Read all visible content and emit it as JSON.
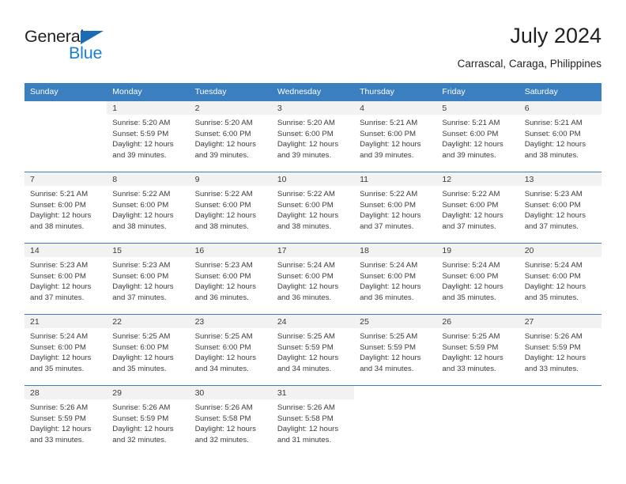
{
  "brand": {
    "name_part1": "General",
    "name_part2": "Blue",
    "triangle_color": "#1b6cb5",
    "blue_color": "#1b7fd4"
  },
  "header": {
    "title": "July 2024",
    "location": "Carrascal, Caraga, Philippines"
  },
  "theme": {
    "header_bg": "#3c7fc0",
    "header_text": "#ffffff",
    "daynum_strip_bg": "#f2f2f2",
    "grid_line": "#3c7fc0",
    "body_text": "#3b3b3b"
  },
  "weekdays": [
    "Sunday",
    "Monday",
    "Tuesday",
    "Wednesday",
    "Thursday",
    "Friday",
    "Saturday"
  ],
  "weeks": [
    [
      {
        "day": "",
        "sunrise": "",
        "sunset": "",
        "daylight1": "",
        "daylight2": ""
      },
      {
        "day": "1",
        "sunrise": "Sunrise: 5:20 AM",
        "sunset": "Sunset: 5:59 PM",
        "daylight1": "Daylight: 12 hours",
        "daylight2": "and 39 minutes."
      },
      {
        "day": "2",
        "sunrise": "Sunrise: 5:20 AM",
        "sunset": "Sunset: 6:00 PM",
        "daylight1": "Daylight: 12 hours",
        "daylight2": "and 39 minutes."
      },
      {
        "day": "3",
        "sunrise": "Sunrise: 5:20 AM",
        "sunset": "Sunset: 6:00 PM",
        "daylight1": "Daylight: 12 hours",
        "daylight2": "and 39 minutes."
      },
      {
        "day": "4",
        "sunrise": "Sunrise: 5:21 AM",
        "sunset": "Sunset: 6:00 PM",
        "daylight1": "Daylight: 12 hours",
        "daylight2": "and 39 minutes."
      },
      {
        "day": "5",
        "sunrise": "Sunrise: 5:21 AM",
        "sunset": "Sunset: 6:00 PM",
        "daylight1": "Daylight: 12 hours",
        "daylight2": "and 39 minutes."
      },
      {
        "day": "6",
        "sunrise": "Sunrise: 5:21 AM",
        "sunset": "Sunset: 6:00 PM",
        "daylight1": "Daylight: 12 hours",
        "daylight2": "and 38 minutes."
      }
    ],
    [
      {
        "day": "7",
        "sunrise": "Sunrise: 5:21 AM",
        "sunset": "Sunset: 6:00 PM",
        "daylight1": "Daylight: 12 hours",
        "daylight2": "and 38 minutes."
      },
      {
        "day": "8",
        "sunrise": "Sunrise: 5:22 AM",
        "sunset": "Sunset: 6:00 PM",
        "daylight1": "Daylight: 12 hours",
        "daylight2": "and 38 minutes."
      },
      {
        "day": "9",
        "sunrise": "Sunrise: 5:22 AM",
        "sunset": "Sunset: 6:00 PM",
        "daylight1": "Daylight: 12 hours",
        "daylight2": "and 38 minutes."
      },
      {
        "day": "10",
        "sunrise": "Sunrise: 5:22 AM",
        "sunset": "Sunset: 6:00 PM",
        "daylight1": "Daylight: 12 hours",
        "daylight2": "and 38 minutes."
      },
      {
        "day": "11",
        "sunrise": "Sunrise: 5:22 AM",
        "sunset": "Sunset: 6:00 PM",
        "daylight1": "Daylight: 12 hours",
        "daylight2": "and 37 minutes."
      },
      {
        "day": "12",
        "sunrise": "Sunrise: 5:22 AM",
        "sunset": "Sunset: 6:00 PM",
        "daylight1": "Daylight: 12 hours",
        "daylight2": "and 37 minutes."
      },
      {
        "day": "13",
        "sunrise": "Sunrise: 5:23 AM",
        "sunset": "Sunset: 6:00 PM",
        "daylight1": "Daylight: 12 hours",
        "daylight2": "and 37 minutes."
      }
    ],
    [
      {
        "day": "14",
        "sunrise": "Sunrise: 5:23 AM",
        "sunset": "Sunset: 6:00 PM",
        "daylight1": "Daylight: 12 hours",
        "daylight2": "and 37 minutes."
      },
      {
        "day": "15",
        "sunrise": "Sunrise: 5:23 AM",
        "sunset": "Sunset: 6:00 PM",
        "daylight1": "Daylight: 12 hours",
        "daylight2": "and 37 minutes."
      },
      {
        "day": "16",
        "sunrise": "Sunrise: 5:23 AM",
        "sunset": "Sunset: 6:00 PM",
        "daylight1": "Daylight: 12 hours",
        "daylight2": "and 36 minutes."
      },
      {
        "day": "17",
        "sunrise": "Sunrise: 5:24 AM",
        "sunset": "Sunset: 6:00 PM",
        "daylight1": "Daylight: 12 hours",
        "daylight2": "and 36 minutes."
      },
      {
        "day": "18",
        "sunrise": "Sunrise: 5:24 AM",
        "sunset": "Sunset: 6:00 PM",
        "daylight1": "Daylight: 12 hours",
        "daylight2": "and 36 minutes."
      },
      {
        "day": "19",
        "sunrise": "Sunrise: 5:24 AM",
        "sunset": "Sunset: 6:00 PM",
        "daylight1": "Daylight: 12 hours",
        "daylight2": "and 35 minutes."
      },
      {
        "day": "20",
        "sunrise": "Sunrise: 5:24 AM",
        "sunset": "Sunset: 6:00 PM",
        "daylight1": "Daylight: 12 hours",
        "daylight2": "and 35 minutes."
      }
    ],
    [
      {
        "day": "21",
        "sunrise": "Sunrise: 5:24 AM",
        "sunset": "Sunset: 6:00 PM",
        "daylight1": "Daylight: 12 hours",
        "daylight2": "and 35 minutes."
      },
      {
        "day": "22",
        "sunrise": "Sunrise: 5:25 AM",
        "sunset": "Sunset: 6:00 PM",
        "daylight1": "Daylight: 12 hours",
        "daylight2": "and 35 minutes."
      },
      {
        "day": "23",
        "sunrise": "Sunrise: 5:25 AM",
        "sunset": "Sunset: 6:00 PM",
        "daylight1": "Daylight: 12 hours",
        "daylight2": "and 34 minutes."
      },
      {
        "day": "24",
        "sunrise": "Sunrise: 5:25 AM",
        "sunset": "Sunset: 5:59 PM",
        "daylight1": "Daylight: 12 hours",
        "daylight2": "and 34 minutes."
      },
      {
        "day": "25",
        "sunrise": "Sunrise: 5:25 AM",
        "sunset": "Sunset: 5:59 PM",
        "daylight1": "Daylight: 12 hours",
        "daylight2": "and 34 minutes."
      },
      {
        "day": "26",
        "sunrise": "Sunrise: 5:25 AM",
        "sunset": "Sunset: 5:59 PM",
        "daylight1": "Daylight: 12 hours",
        "daylight2": "and 33 minutes."
      },
      {
        "day": "27",
        "sunrise": "Sunrise: 5:26 AM",
        "sunset": "Sunset: 5:59 PM",
        "daylight1": "Daylight: 12 hours",
        "daylight2": "and 33 minutes."
      }
    ],
    [
      {
        "day": "28",
        "sunrise": "Sunrise: 5:26 AM",
        "sunset": "Sunset: 5:59 PM",
        "daylight1": "Daylight: 12 hours",
        "daylight2": "and 33 minutes."
      },
      {
        "day": "29",
        "sunrise": "Sunrise: 5:26 AM",
        "sunset": "Sunset: 5:59 PM",
        "daylight1": "Daylight: 12 hours",
        "daylight2": "and 32 minutes."
      },
      {
        "day": "30",
        "sunrise": "Sunrise: 5:26 AM",
        "sunset": "Sunset: 5:58 PM",
        "daylight1": "Daylight: 12 hours",
        "daylight2": "and 32 minutes."
      },
      {
        "day": "31",
        "sunrise": "Sunrise: 5:26 AM",
        "sunset": "Sunset: 5:58 PM",
        "daylight1": "Daylight: 12 hours",
        "daylight2": "and 31 minutes."
      },
      {
        "day": "",
        "sunrise": "",
        "sunset": "",
        "daylight1": "",
        "daylight2": ""
      },
      {
        "day": "",
        "sunrise": "",
        "sunset": "",
        "daylight1": "",
        "daylight2": ""
      },
      {
        "day": "",
        "sunrise": "",
        "sunset": "",
        "daylight1": "",
        "daylight2": ""
      }
    ]
  ]
}
